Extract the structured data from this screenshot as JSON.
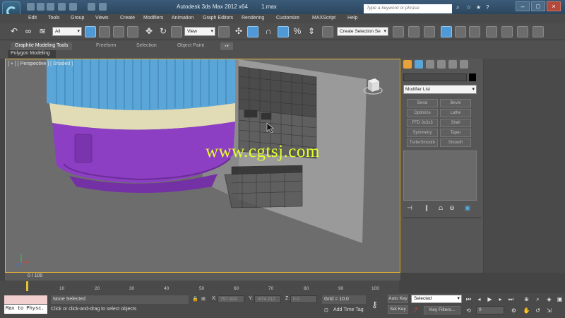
{
  "window": {
    "title": "Autodesk 3ds Max  2012 x64",
    "file": "1.max",
    "search_placeholder": "Type a keyword or phrase"
  },
  "menu": [
    "Edit",
    "Tools",
    "Group",
    "Views",
    "Create",
    "Modifiers",
    "Animation",
    "Graph Editors",
    "Rendering",
    "Customize",
    "MAXScript",
    "Help"
  ],
  "toolbar": {
    "selection_filter": "All",
    "reference_coord": "View",
    "named_selection": "Create Selection Se"
  },
  "ribbon": {
    "tabs": [
      "Graphite Modeling Tools",
      "Freeform",
      "Selection",
      "Object Paint"
    ],
    "panel": "Polygon Modeling"
  },
  "viewport": {
    "label": "[ + ] [ Perspective ] [ Shaded ]",
    "watermark": "www.cgtsj.com"
  },
  "command_panel": {
    "modifier_list": "Modifier List",
    "modifiers": [
      "Bend",
      "Bevel",
      "Optimize",
      "Lathe",
      "FFD 3x3x3",
      "Shell",
      "Symmetry",
      "Taper",
      "TurboSmooth",
      "Smooth"
    ]
  },
  "timeline": {
    "readout": "0 / 100",
    "ticks": [
      "10",
      "20",
      "30",
      "40",
      "50",
      "60",
      "70",
      "80",
      "90",
      "100"
    ]
  },
  "status": {
    "listener": "Max to Physc.",
    "selection": "None Selected",
    "prompt": "Click or click-and-drag to select objects",
    "x_label": "X:",
    "y_label": "Y:",
    "z_label": "Z:",
    "x": "797.829",
    "y": "-674.212",
    "z": "0.0",
    "grid": "Grid = 10.0",
    "add_time_tag": "Add Time Tag",
    "auto_key": "Auto Key",
    "set_key": "Set Key",
    "key_mode": "Selected",
    "key_filters": "Key Filters...",
    "frame": "0"
  },
  "colors": {
    "viewport_border": "#e0b13a",
    "watermark": "#e5ff2b",
    "cylinder_blue": "#5aa6d8",
    "ring_cream": "#e2dcb6",
    "base_purple": "#8d3fc4"
  }
}
